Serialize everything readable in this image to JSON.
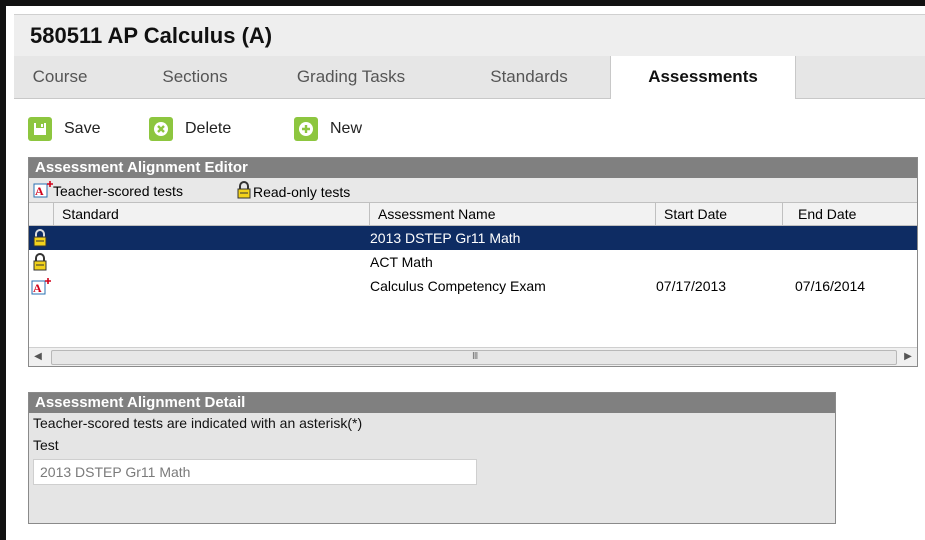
{
  "course": {
    "title": "580511 AP Calculus (A)"
  },
  "tabs": [
    {
      "label": "Course",
      "active": false
    },
    {
      "label": "Sections",
      "active": false
    },
    {
      "label": "Grading Tasks",
      "active": false
    },
    {
      "label": "Standards",
      "active": false
    },
    {
      "label": "Assessments",
      "active": true
    }
  ],
  "toolbar": {
    "save_label": "Save",
    "delete_label": "Delete",
    "new_label": "New"
  },
  "editor": {
    "title": "Assessment Alignment Editor",
    "legend": {
      "teacher_scored": "Teacher-scored tests",
      "read_only": "Read-only tests"
    },
    "columns": [
      "Standard",
      "Assessment Name",
      "Start Date",
      "End Date"
    ],
    "rows": [
      {
        "icon": "lock-icon",
        "standard": "",
        "name": "2013 DSTEP Gr11 Math",
        "start": "",
        "end": "",
        "selected": true
      },
      {
        "icon": "lock-icon",
        "standard": "",
        "name": "ACT Math",
        "start": "",
        "end": "",
        "selected": false
      },
      {
        "icon": "teacher-scored-icon",
        "standard": "",
        "name": "Calculus Competency Exam",
        "start": "07/17/2013",
        "end": "07/16/2014",
        "selected": false
      }
    ]
  },
  "detail": {
    "title": "Assessment Alignment Detail",
    "note": "Teacher-scored tests are indicated with an asterisk(*)",
    "test_label": "Test",
    "test_value": "2013 DSTEP Gr11 Math"
  },
  "colors": {
    "accent_green": "#8dc63f",
    "selected_row": "#0e2c63",
    "panel_header": "#808080"
  }
}
